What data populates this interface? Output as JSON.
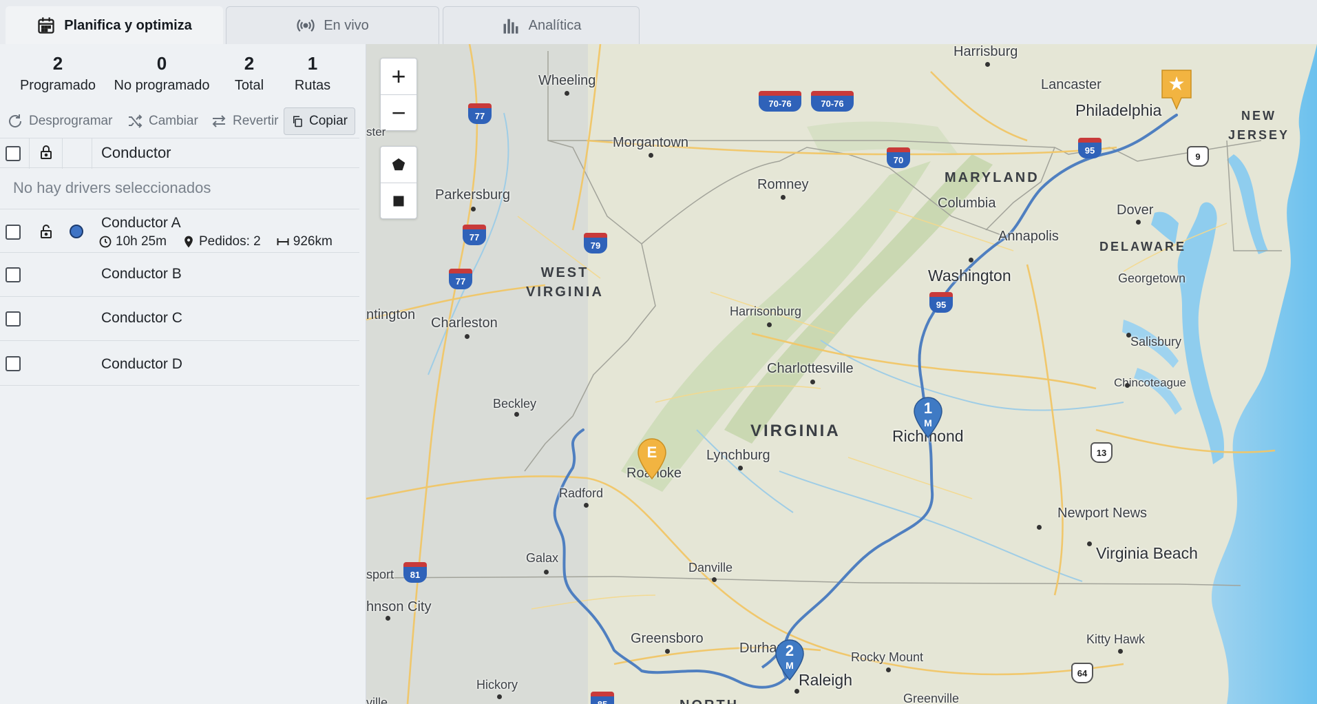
{
  "tabs": [
    {
      "label": "Planifica y optimiza",
      "icon": "calendar-icon",
      "active": true
    },
    {
      "label": "En vivo",
      "icon": "broadcast-icon",
      "active": false
    },
    {
      "label": "Analítica",
      "icon": "bar-chart-icon",
      "active": false
    }
  ],
  "stats": [
    {
      "value": "2",
      "label": "Programado"
    },
    {
      "value": "0",
      "label": "No programado"
    },
    {
      "value": "2",
      "label": "Total"
    },
    {
      "value": "1",
      "label": "Rutas"
    }
  ],
  "actions": {
    "unschedule": "Desprogramar",
    "change": "Cambiar",
    "revert": "Revertir",
    "copy": "Copiar"
  },
  "table": {
    "header": "Conductor",
    "empty_message": "No hay drivers seleccionados",
    "drivers": [
      {
        "name": "Conductor A",
        "time": "10h 25m",
        "orders": "Pedidos: 2",
        "distance": "926km",
        "color": "#3f74c5"
      },
      {
        "name": "Conductor B"
      },
      {
        "name": "Conductor C"
      },
      {
        "name": "Conductor D"
      }
    ]
  },
  "map": {
    "zoom_in": "+",
    "zoom_out": "−",
    "tools": [
      "polygon-draw-icon",
      "rectangle-draw-icon"
    ],
    "states": [
      "WEST\nVIRGINIA",
      "VIRGINIA",
      "MARYLAND",
      "DELAWARE",
      "NEW\nJERSEY",
      "NORTH"
    ],
    "cities": [
      "Harrisburg",
      "Lancaster",
      "Philadelphia",
      "Wheeling",
      "Morgantown",
      "Romney",
      "Columbia",
      "Dover",
      "Annapolis",
      "Parkersburg",
      "Washington",
      "Georgetown",
      "Harrisonburg",
      "Salisbury",
      "ntington",
      "Charleston",
      "Charlottesville",
      "Chincoteague",
      "Beckley",
      "Lynchburg",
      "Richmond",
      "Roanoke",
      "Radford",
      "Newport News",
      "Virginia Beach",
      "Galax",
      "Danville",
      "sport",
      "hnson City",
      "Greensboro",
      "Durham",
      "Rocky Mount",
      "Kitty Hawk",
      "Raleigh",
      "Hickory",
      "Greenville",
      "ville",
      "ster"
    ],
    "highways": [
      "77",
      "70-76",
      "70-76",
      "70",
      "95",
      "9",
      "77",
      "79",
      "77",
      "95",
      "13",
      "81",
      "64",
      "85"
    ],
    "stops": [
      {
        "label": "1",
        "sub": "M",
        "color": "#3f7ac4"
      },
      {
        "label": "2",
        "sub": "M",
        "color": "#3f7ac4"
      },
      {
        "label": "E",
        "sub": "",
        "color": "#f2b441"
      },
      {
        "label": "★",
        "sub": "",
        "color": "#f2b441"
      }
    ],
    "route_color": "#4f7fc0"
  }
}
